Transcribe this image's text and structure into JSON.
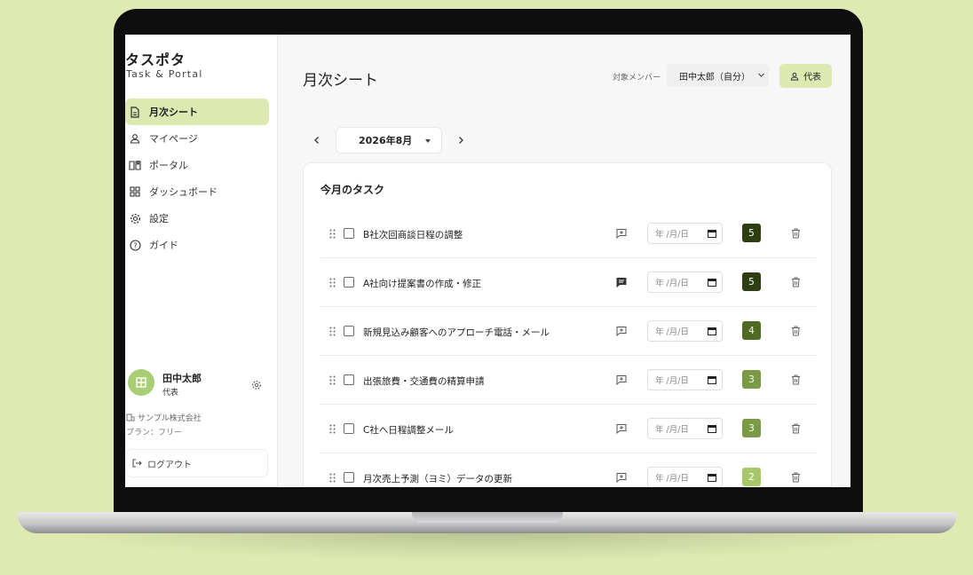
{
  "sidebar": {
    "brand_title": "タスポタ",
    "brand_subtitle": "Task & Portal",
    "items": [
      {
        "label": "月次シート",
        "icon": "document-icon",
        "active": true
      },
      {
        "label": "マイページ",
        "icon": "user-icon",
        "active": false
      },
      {
        "label": "ポータル",
        "icon": "book-icon",
        "active": false
      },
      {
        "label": "ダッシュボード",
        "icon": "dashboard-icon",
        "active": false
      },
      {
        "label": "設定",
        "icon": "gear-icon",
        "active": false
      },
      {
        "label": "ガイド",
        "icon": "help-icon",
        "active": false
      }
    ],
    "user": {
      "name": "田中太郎",
      "role": "代表",
      "avatar_glyph": "田"
    },
    "company": "サンプル株式会社",
    "plan": "プラン：フリー",
    "logout_label": "ログアウト"
  },
  "header": {
    "title": "月次シート",
    "member_label": "対象メンバー",
    "member_value": "田中太郎（自分）",
    "role_button": "代表"
  },
  "month": {
    "value": "2026年8月"
  },
  "card": {
    "title": "今月のタスク",
    "date_placeholder": "年 /月/日",
    "tasks": [
      {
        "name": "B社次回商談日程の調整",
        "priority": "5",
        "has_comment": false
      },
      {
        "name": "A社向け提案書の作成・修正",
        "priority": "5",
        "has_comment": true
      },
      {
        "name": "新規見込み顧客へのアプローチ電話・メール",
        "priority": "4",
        "has_comment": false
      },
      {
        "name": "出張旅費・交通費の精算申請",
        "priority": "3",
        "has_comment": false
      },
      {
        "name": "C社へ日程調整メール",
        "priority": "3",
        "has_comment": false
      },
      {
        "name": "月次売上予測（ヨミ）データの更新",
        "priority": "2",
        "has_comment": false
      }
    ]
  },
  "colors": {
    "accent": "#dceab2",
    "background": "#dfeab2",
    "priority_5": "#2f3d12",
    "priority_4": "#4f6b23",
    "priority_3": "#7a9a45",
    "priority_2": "#a8c76b"
  }
}
